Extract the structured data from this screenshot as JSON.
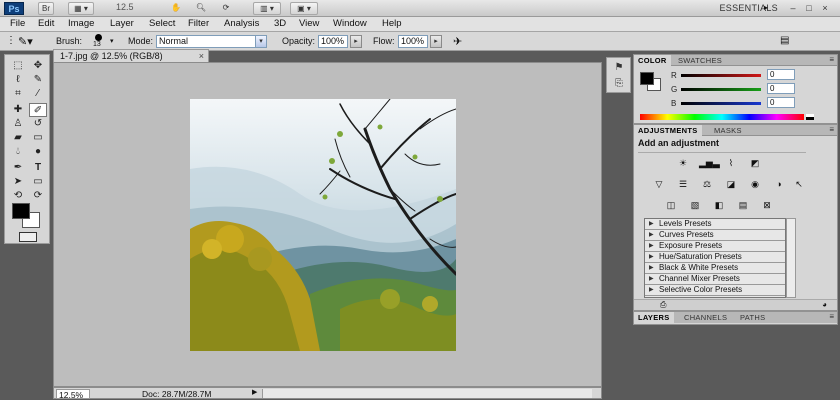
{
  "appbar": {
    "logo": "Ps",
    "bridge_btn": "Br",
    "zoom_value": "12.5",
    "workspace": "ESSENTIALS",
    "win_min": "–",
    "win_max": "□",
    "win_close": "×"
  },
  "menu": [
    "File",
    "Edit",
    "Image",
    "Layer",
    "Select",
    "Filter",
    "Analysis",
    "3D",
    "View",
    "Window",
    "Help"
  ],
  "options": {
    "brush_label": "Brush:",
    "brush_size": "13",
    "mode_label": "Mode:",
    "mode_value": "Normal",
    "opacity_label": "Opacity:",
    "opacity_value": "100%",
    "flow_label": "Flow:",
    "flow_value": "100%"
  },
  "document": {
    "tab_title": "1-7.jpg @ 12.5% (RGB/8)",
    "tab_close": "×"
  },
  "status": {
    "zoom": "12.5%",
    "doc_info": "Doc: 28.7M/28.7M",
    "arrow": "▶"
  },
  "color_panel": {
    "tabs": [
      "COLOR",
      "SWATCHES"
    ],
    "channels": [
      {
        "label": "R",
        "value": "0",
        "color": "#d01818"
      },
      {
        "label": "G",
        "value": "0",
        "color": "#18a018"
      },
      {
        "label": "B",
        "value": "0",
        "color": "#1838d0"
      }
    ]
  },
  "adjustments_panel": {
    "tabs": [
      "ADJUSTMENTS",
      "MASKS"
    ],
    "title": "Add an adjustment",
    "presets": [
      "Levels Presets",
      "Curves Presets",
      "Exposure Presets",
      "Hue/Saturation Presets",
      "Black & White Presets",
      "Channel Mixer Presets",
      "Selective Color Presets"
    ]
  },
  "layers_panel": {
    "tabs": [
      "LAYERS",
      "CHANNELS",
      "PATHS"
    ]
  }
}
